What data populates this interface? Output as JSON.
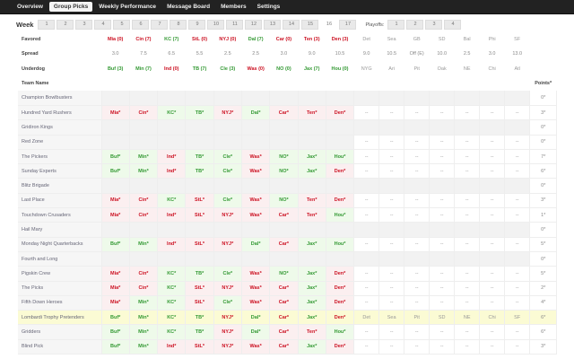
{
  "nav": [
    "Overview",
    "Group Picks",
    "Weekly Performance",
    "Message Board",
    "Members",
    "Settings"
  ],
  "nav_active": 1,
  "week_label": "Week",
  "weeks": [
    "1",
    "2",
    "3",
    "4",
    "5",
    "6",
    "7",
    "8",
    "9",
    "10",
    "11",
    "12",
    "13",
    "14",
    "15",
    "16",
    "17"
  ],
  "week_active": 15,
  "playoffs_label": "Playoffs:",
  "playoffs": [
    "1",
    "2",
    "3",
    "4"
  ],
  "colors": {
    "correct": "#339933",
    "wrong": "#cc1122",
    "highlight": "#fbfbd4"
  },
  "lines": {
    "favored_label": "Favored",
    "spread_label": "Spread",
    "underdog_label": "Underdog",
    "favored": [
      [
        "Mia (0)",
        "r"
      ],
      [
        "Cin (7)",
        "r"
      ],
      [
        "KC (7)",
        "g"
      ],
      [
        "StL (0)",
        "r"
      ],
      [
        "NYJ (0)",
        "r"
      ],
      [
        "Dal (7)",
        "g"
      ],
      [
        "Car (0)",
        "r"
      ],
      [
        "Ten (3)",
        "r"
      ],
      [
        "Den (3)",
        "r"
      ],
      [
        "Det",
        ""
      ],
      [
        "Sea",
        ""
      ],
      [
        "GB",
        ""
      ],
      [
        "SD",
        ""
      ],
      [
        "Bal",
        ""
      ],
      [
        "Phi",
        ""
      ],
      [
        "SF",
        ""
      ]
    ],
    "spread": [
      "3.0",
      "7.5",
      "6.5",
      "5.5",
      "2.5",
      "2.5",
      "3.0",
      "9.0",
      "10.5",
      "9.0",
      "10.5",
      "Off (E)",
      "10.0",
      "2.5",
      "3.0",
      "13.0"
    ],
    "underdog": [
      [
        "Buf (3)",
        "g"
      ],
      [
        "Min (7)",
        "g"
      ],
      [
        "Ind (0)",
        "r"
      ],
      [
        "TB (7)",
        "g"
      ],
      [
        "Cle (3)",
        "g"
      ],
      [
        "Was (0)",
        "r"
      ],
      [
        "NO (0)",
        "g"
      ],
      [
        "Jax (7)",
        "g"
      ],
      [
        "Hou (0)",
        "g"
      ],
      [
        "NYG",
        ""
      ],
      [
        "Ari",
        ""
      ],
      [
        "Pit",
        ""
      ],
      [
        "Oak",
        ""
      ],
      [
        "NE",
        ""
      ],
      [
        "Chi",
        ""
      ],
      [
        "Atl",
        ""
      ]
    ]
  },
  "team_header": "Team Name",
  "points_header": "Points*",
  "team_colors": {
    "Mia*": "r",
    "Cin*": "r",
    "KC*": "g",
    "TB*": "g",
    "NYJ*": "r",
    "Dal*": "g",
    "Car*": "r",
    "Ten*": "r",
    "Den*": "r",
    "Buf*": "g",
    "Min*": "g",
    "Ind*": "r",
    "StL*": "r",
    "Cle*": "g",
    "Was*": "r",
    "NO*": "g",
    "Jax*": "g",
    "Hou*": "g"
  },
  "rows": [
    {
      "name": "Champion Bowlbusters",
      "picks": [],
      "playoffs": [],
      "points": "0*"
    },
    {
      "name": "Hundred Yard Rushers",
      "picks": [
        "Mia*",
        "Cin*",
        "KC*",
        "TB*",
        "NYJ*",
        "Dal*",
        "Car*",
        "Ten*",
        "Den*"
      ],
      "playoffs": [
        "--",
        "--",
        "--",
        "--",
        "--",
        "--",
        "--"
      ],
      "points": "3*"
    },
    {
      "name": "Gridiron Kings",
      "picks": [],
      "playoffs": [],
      "points": "0*"
    },
    {
      "name": "Red Zone",
      "picks": [],
      "playoffs": [
        "--",
        "--",
        "--",
        "--",
        "--",
        "--",
        "--"
      ],
      "points": "0*"
    },
    {
      "name": "The Pickers",
      "picks": [
        "Buf*",
        "Min*",
        "Ind*",
        "TB*",
        "Cle*",
        "Was*",
        "NO*",
        "Jax*",
        "Hou*"
      ],
      "playoffs": [
        "--",
        "--",
        "--",
        "--",
        "--",
        "--",
        "--"
      ],
      "points": "7*"
    },
    {
      "name": "Sunday Experts",
      "picks": [
        "Buf*",
        "Min*",
        "Ind*",
        "TB*",
        "Cle*",
        "Was*",
        "NO*",
        "Jax*",
        "Den*"
      ],
      "playoffs": [
        "--",
        "--",
        "--",
        "--",
        "--",
        "--",
        "--"
      ],
      "points": "6*"
    },
    {
      "name": "Blitz Brigade",
      "picks": [],
      "playoffs": [],
      "points": "0*"
    },
    {
      "name": "Last Place",
      "picks": [
        "Mia*",
        "Cin*",
        "KC*",
        "StL*",
        "Cle*",
        "Was*",
        "NO*",
        "Ten*",
        "Den*"
      ],
      "playoffs": [
        "--",
        "--",
        "--",
        "--",
        "--",
        "--",
        "--"
      ],
      "points": "3*"
    },
    {
      "name": "Touchdown Crusaders",
      "picks": [
        "Mia*",
        "Cin*",
        "Ind*",
        "StL*",
        "NYJ*",
        "Was*",
        "Car*",
        "Ten*",
        "Hou*"
      ],
      "playoffs": [
        "--",
        "--",
        "--",
        "--",
        "--",
        "--",
        "--"
      ],
      "points": "1*"
    },
    {
      "name": "Hail Mary",
      "picks": [],
      "playoffs": [],
      "points": "0*"
    },
    {
      "name": "Monday Night Quarterbacks",
      "picks": [
        "Buf*",
        "Min*",
        "Ind*",
        "StL*",
        "NYJ*",
        "Dal*",
        "Car*",
        "Jax*",
        "Hou*"
      ],
      "playoffs": [
        "--",
        "--",
        "--",
        "--",
        "--",
        "--",
        "--"
      ],
      "points": "5*"
    },
    {
      "name": "Fourth and Long",
      "picks": [],
      "playoffs": [],
      "points": "0*"
    },
    {
      "name": "Pigskin Crew",
      "picks": [
        "Mia*",
        "Cin*",
        "KC*",
        "TB*",
        "Cle*",
        "Was*",
        "NO*",
        "Jax*",
        "Den*"
      ],
      "playoffs": [
        "--",
        "--",
        "--",
        "--",
        "--",
        "--",
        "--"
      ],
      "points": "5*"
    },
    {
      "name": "The Picks",
      "picks": [
        "Mia*",
        "Cin*",
        "KC*",
        "StL*",
        "NYJ*",
        "Was*",
        "Car*",
        "Jax*",
        "Den*"
      ],
      "playoffs": [
        "--",
        "--",
        "--",
        "--",
        "--",
        "--",
        "--"
      ],
      "points": "2*"
    },
    {
      "name": "Fifth Down Heroes",
      "picks": [
        "Mia*",
        "Min*",
        "KC*",
        "StL*",
        "Cle*",
        "Was*",
        "Car*",
        "Jax*",
        "Den*"
      ],
      "playoffs": [
        "--",
        "--",
        "--",
        "--",
        "--",
        "--",
        "--"
      ],
      "points": "4*"
    },
    {
      "name": "Lombardi Trophy Pretenders",
      "picks": [
        "Buf*",
        "Min*",
        "KC*",
        "TB*",
        "NYJ*",
        "Dal*",
        "Car*",
        "Jax*",
        "Den*"
      ],
      "playoffs": [
        "Det",
        "Sea",
        "Pit",
        "SD",
        "NE",
        "Chi",
        "SF"
      ],
      "points": "6*",
      "highlight": true
    },
    {
      "name": "Gridders",
      "picks": [
        "Buf*",
        "Min*",
        "KC*",
        "TB*",
        "NYJ*",
        "Dal*",
        "Car*",
        "Ten*",
        "Hou*"
      ],
      "playoffs": [
        "--",
        "--",
        "--",
        "--",
        "--",
        "--",
        "--"
      ],
      "points": "6*"
    },
    {
      "name": "Blind Pick",
      "picks": [
        "Buf*",
        "Min*",
        "Ind*",
        "StL*",
        "NYJ*",
        "Was*",
        "Car*",
        "Jax*",
        "Den*"
      ],
      "playoffs": [
        "--",
        "--",
        "--",
        "--",
        "--",
        "--",
        "--"
      ],
      "points": "3*"
    }
  ]
}
